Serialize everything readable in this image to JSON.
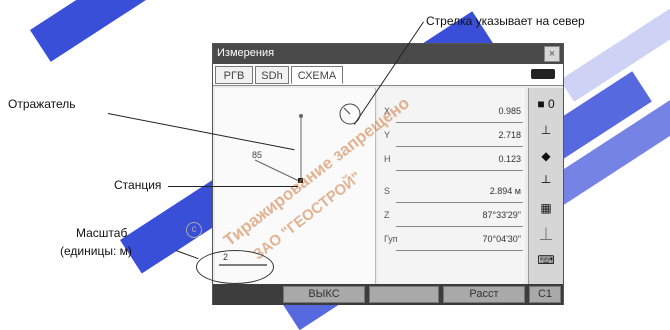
{
  "annotations": {
    "north_arrow": "Стрелка указывает на север",
    "reflector": "Отражатель",
    "station": "Станция",
    "scale_line1": "Масштаб",
    "scale_line2": "(единицы: м)"
  },
  "watermark": {
    "line1": "Тиражирование запрещено",
    "line2": "ЗАО \"ГЕОСТРОЙ\""
  },
  "window": {
    "title": "Измерения",
    "close": "×",
    "tabs": [
      "РГВ",
      "SDh",
      "СХЕМА"
    ],
    "active_tab": "СХЕМА"
  },
  "plot": {
    "angle_label": "85",
    "scale_value": "2"
  },
  "values": [
    {
      "label": "X",
      "value": "0.985"
    },
    {
      "label": "Y",
      "value": "2.718"
    },
    {
      "label": "H",
      "value": "0.123"
    },
    {
      "label": "S",
      "value": "2.894 м"
    },
    {
      "label": "Z",
      "value": "87°33'29\""
    },
    {
      "label": "Гуп",
      "value": "70°04'30\""
    }
  ],
  "sidebar": {
    "icons": [
      "battery-icon",
      "target-icon",
      "prism-icon",
      "tilt-icon",
      "level-icon",
      "laser-icon",
      "input-icon"
    ],
    "prism_const": "0"
  },
  "bottom": {
    "button1": "ВЫКС",
    "button2": "Расст",
    "page": "С1"
  }
}
